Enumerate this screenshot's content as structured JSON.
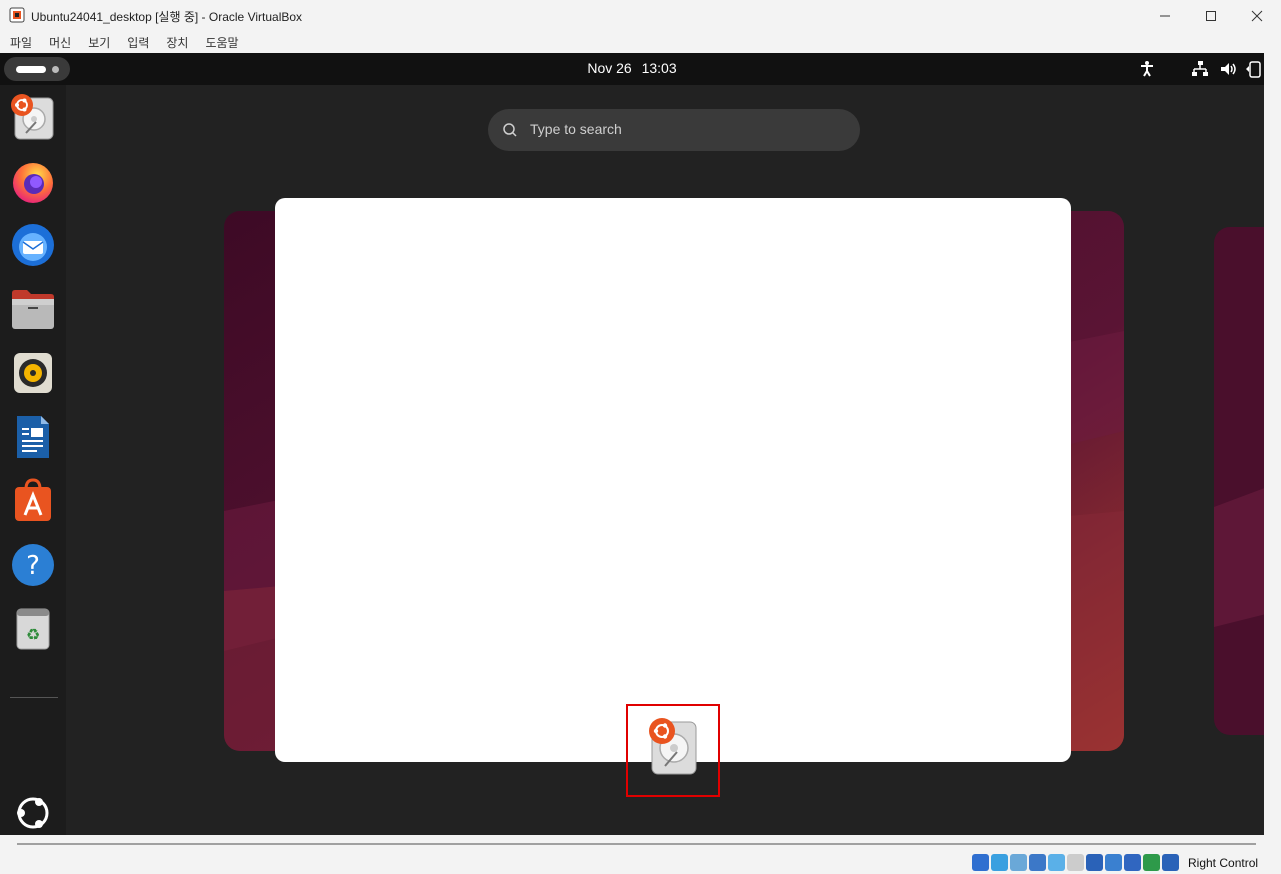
{
  "host": {
    "title": "Ubuntu24041_desktop [실행 중] - Oracle VirtualBox",
    "minimize_icon": "minimize-icon",
    "maximize_icon": "maximize-icon",
    "close_icon": "close-icon",
    "menu": [
      "파일",
      "머신",
      "보기",
      "입력",
      "장치",
      "도움말"
    ],
    "host_key": "Right Control"
  },
  "guest": {
    "date": "Nov 26",
    "time": "13:03",
    "search": {
      "placeholder": "Type to search"
    },
    "dock": [
      {
        "name": "disk-utility-icon"
      },
      {
        "name": "firefox-icon"
      },
      {
        "name": "thunderbird-icon"
      },
      {
        "name": "files-icon"
      },
      {
        "name": "rhythmbox-icon"
      },
      {
        "name": "libreoffice-writer-icon"
      },
      {
        "name": "app-center-icon"
      },
      {
        "name": "help-icon"
      },
      {
        "name": "trash-icon"
      }
    ],
    "tray": [
      "accessibility-icon",
      "network-icon",
      "volume-icon",
      "battery-icon"
    ],
    "colors": {
      "accent": "#e95420",
      "panel": "#111111",
      "background": "#222222"
    }
  }
}
